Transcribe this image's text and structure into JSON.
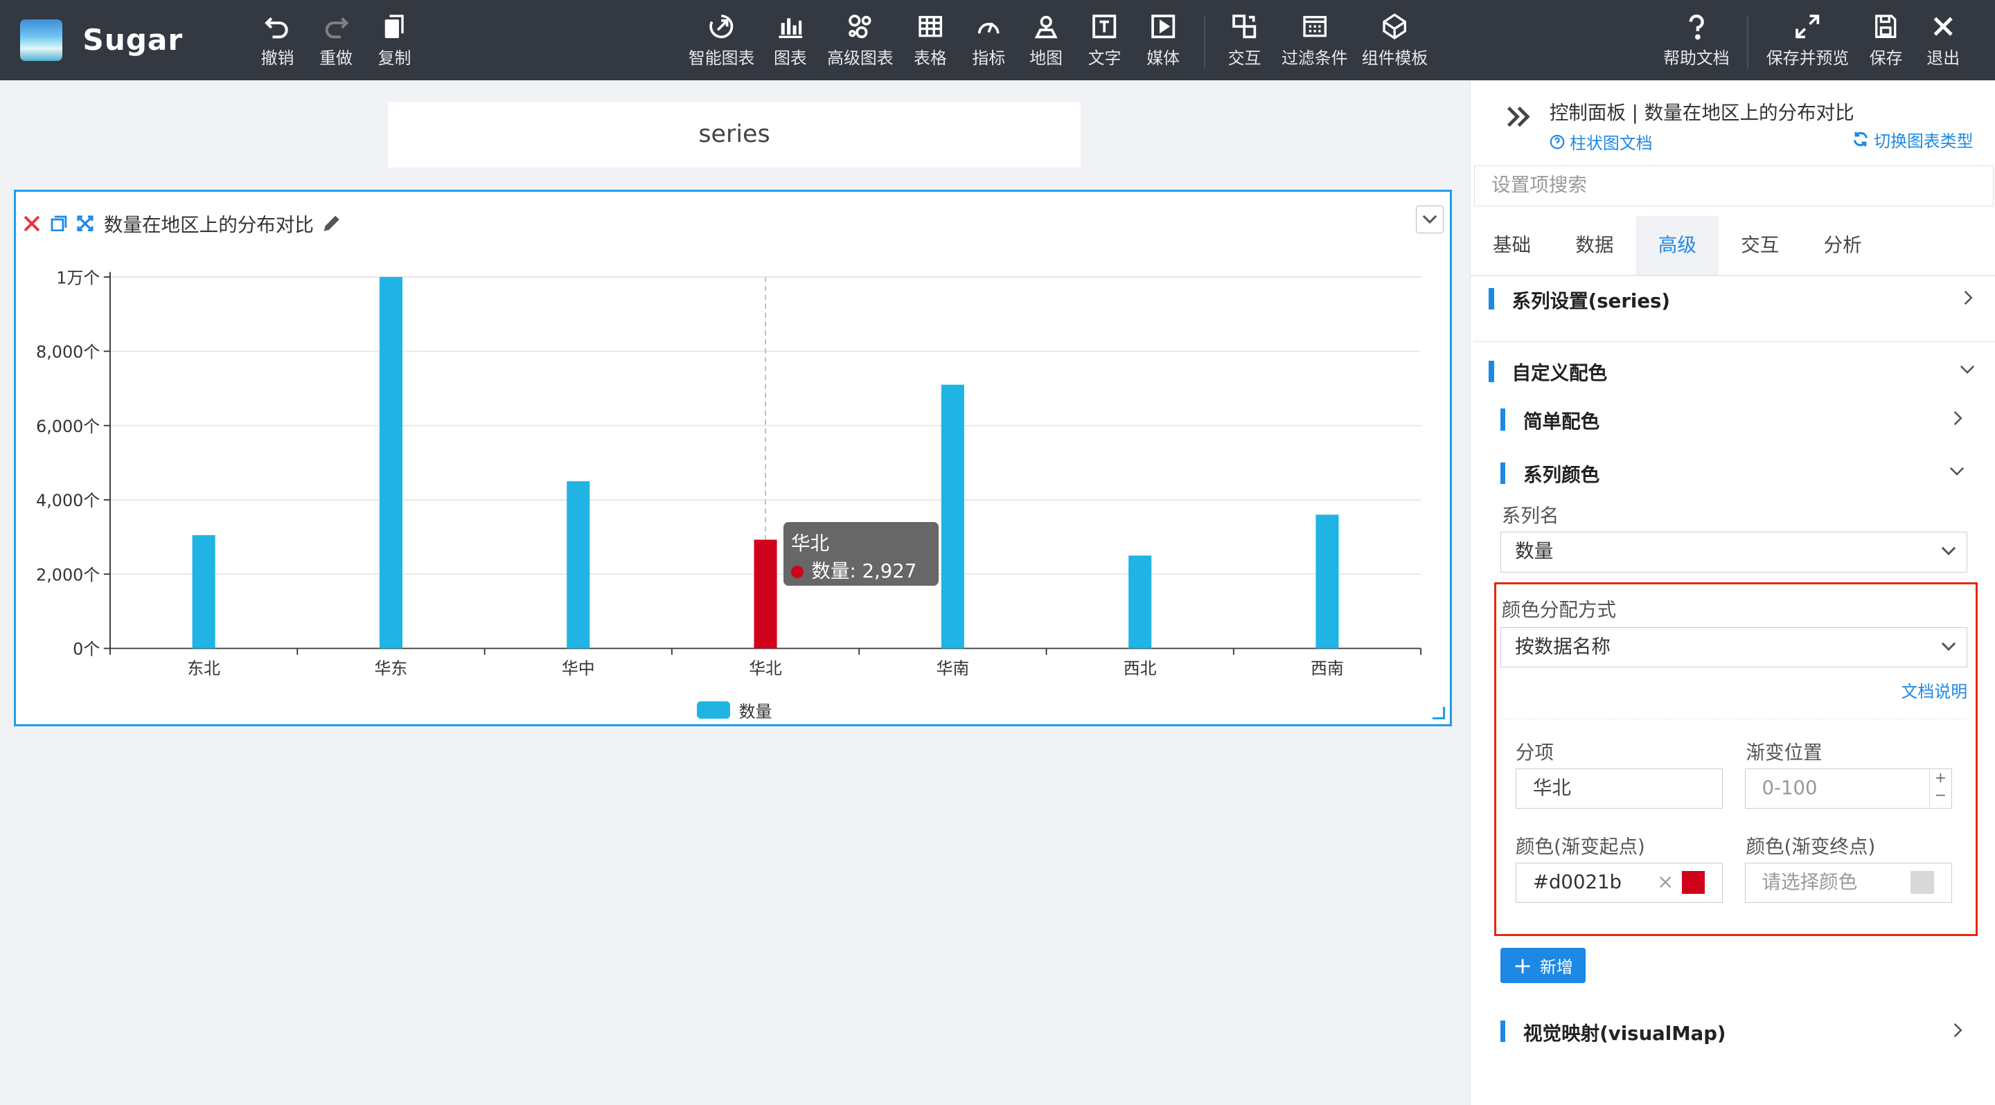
{
  "app": {
    "name": "Sugar"
  },
  "toolbar": {
    "left": [
      {
        "label": "撤销",
        "icon": "undo-icon"
      },
      {
        "label": "重做",
        "icon": "redo-icon"
      },
      {
        "label": "复制",
        "icon": "copy-icon"
      }
    ],
    "center": [
      {
        "label": "智能图表",
        "icon": "smart-chart-icon"
      },
      {
        "label": "图表",
        "icon": "bar-chart-icon"
      },
      {
        "label": "高级图表",
        "icon": "advanced-chart-icon"
      },
      {
        "label": "表格",
        "icon": "table-icon"
      },
      {
        "label": "指标",
        "icon": "gauge-icon"
      },
      {
        "label": "地图",
        "icon": "map-icon"
      },
      {
        "label": "文字",
        "icon": "text-icon"
      },
      {
        "label": "媒体",
        "icon": "media-icon"
      },
      {
        "label": "交互",
        "icon": "interaction-icon"
      },
      {
        "label": "过滤条件",
        "icon": "filter-icon"
      },
      {
        "label": "组件模板",
        "icon": "component-template-icon"
      }
    ],
    "right": [
      {
        "label": "帮助文档",
        "icon": "help-icon"
      },
      {
        "label": "保存并预览",
        "icon": "save-preview-icon"
      },
      {
        "label": "保存",
        "icon": "save-icon"
      },
      {
        "label": "退出",
        "icon": "exit-icon"
      }
    ]
  },
  "canvas": {
    "text_box": "series",
    "widget_title": "数量在地区上的分布对比"
  },
  "chart_data": {
    "type": "bar",
    "categories": [
      "东北",
      "华东",
      "华中",
      "华北",
      "华南",
      "西北",
      "西南"
    ],
    "series": [
      {
        "name": "数量",
        "values": [
          3050,
          10000,
          4500,
          2927,
          7100,
          2500,
          3600
        ]
      }
    ],
    "highlight": {
      "category": "华北",
      "color": "#d0021b"
    },
    "bar_color": "#1fb4e3",
    "ylim": [
      0,
      10000
    ],
    "y_ticks": [
      "0个",
      "2,000个",
      "4,000个",
      "6,000个",
      "8,000个",
      "1万个"
    ],
    "tooltip": {
      "title": "华北",
      "line": "数量: 2,927个"
    },
    "legend": {
      "label": "数量",
      "position": "bottom"
    }
  },
  "panel": {
    "header": "控制面板 | 数量在地区上的分布对比",
    "doc_link": "柱状图文档",
    "switch_link": "切换图表类型",
    "search_placeholder": "设置项搜索",
    "tabs": [
      "基础",
      "数据",
      "高级",
      "交互",
      "分析"
    ],
    "active_tab": "高级",
    "sections": {
      "series_settings": "系列设置(series)",
      "custom_color": "自定义配色",
      "simple_color": "简单配色",
      "series_color": "系列颜色",
      "visual_map": "视觉映射(visualMap)"
    },
    "series_name_label": "系列名",
    "series_name_value": "数量",
    "color_mode_label": "颜色分配方式",
    "color_mode_value": "按数据名称",
    "doc_explain": "文档说明",
    "item_label": "分项",
    "item_value": "华北",
    "gradient_pos_label": "渐变位置",
    "gradient_pos_placeholder": "0-100",
    "color_start_label": "颜色(渐变起点)",
    "color_start_value": "#d0021b",
    "color_end_label": "颜色(渐变终点)",
    "color_end_placeholder": "请选择颜色",
    "add_button": "新增"
  },
  "colors": {
    "accent": "#1e88e5",
    "topbar": "#333841",
    "highlight_border": "#e8270f"
  }
}
